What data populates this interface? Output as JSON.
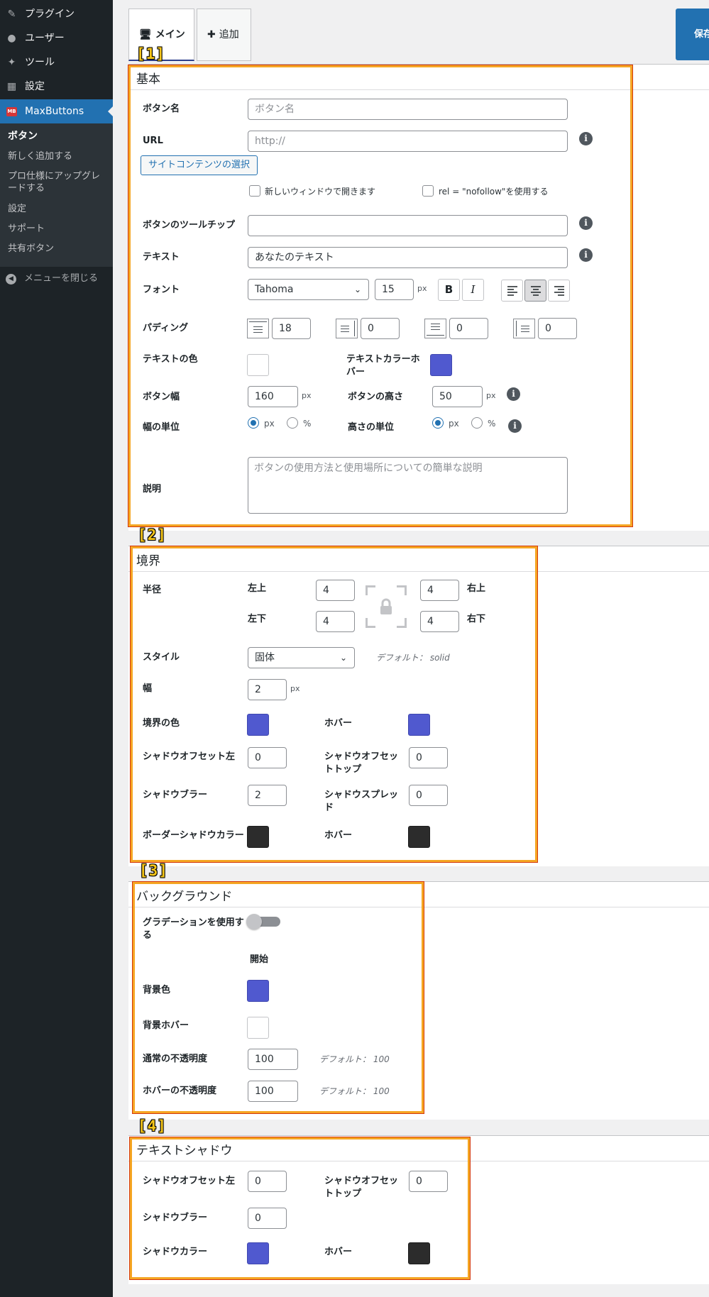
{
  "sidebar": {
    "items": [
      {
        "icon": "plugin-icon",
        "glyph": "✎",
        "label": "プラグイン"
      },
      {
        "icon": "user-icon",
        "glyph": "●",
        "label": "ユーザー"
      },
      {
        "icon": "wrench-icon",
        "glyph": "✦",
        "label": "ツール"
      },
      {
        "icon": "settings-icon",
        "glyph": "▦",
        "label": "設定"
      },
      {
        "icon": "maxbuttons-icon",
        "glyph": "MB",
        "label": "MaxButtons"
      }
    ],
    "submenu": [
      "ボタン",
      "新しく追加する",
      "プロ仕様にアップグレードする",
      "設定",
      "サポート",
      "共有ボタン"
    ],
    "close_menu": "メニューを閉じる"
  },
  "tabs": {
    "main": {
      "icon": "🖥",
      "label": "メイン"
    },
    "add": {
      "icon": "✚",
      "label": "追加"
    },
    "save": "保存"
  },
  "markers": [
    "[1]",
    "[2]",
    "[3]",
    "[4]"
  ],
  "basic": {
    "title": "基本",
    "button_name_label": "ボタン名",
    "button_name_placeholder": "ボタン名",
    "url_label": "URL",
    "url_placeholder": "http://",
    "site_content_button": "サイトコンテンツの選択",
    "new_window_label": "新しいウィンドウで開きます",
    "nofollow_label": "rel = \"nofollow\"を使用する",
    "tooltip_label": "ボタンのツールチップ",
    "text_label": "テキスト",
    "text_value": "あなたのテキスト",
    "font_label": "フォント",
    "font_value": "Tahoma",
    "font_size": "15",
    "px": "px",
    "bold": "B",
    "italic": "I",
    "padding_label": "パディング",
    "padding_values": [
      "18",
      "0",
      "0",
      "0"
    ],
    "text_color_label": "テキストの色",
    "text_color_hover_label": "テキストカラーホバー",
    "button_width_label": "ボタン幅",
    "button_width_value": "160",
    "button_height_label": "ボタンの高さ",
    "button_height_value": "50",
    "width_unit_label": "幅の単位",
    "height_unit_label": "高さの単位",
    "unit_px": "px",
    "unit_percent": "%",
    "description_label": "説明",
    "description_placeholder": "ボタンの使用方法と使用場所についての簡単な説明",
    "info": "i"
  },
  "border": {
    "title": "境界",
    "radius_label": "半径",
    "top_left": "左上",
    "top_right": "右上",
    "bottom_left": "左下",
    "bottom_right": "右下",
    "radius_tl": "4",
    "radius_tr": "4",
    "radius_bl": "4",
    "radius_br": "4",
    "style_label": "スタイル",
    "style_value": "固体",
    "style_default": "デフォルト： solid",
    "width_label": "幅",
    "width_value": "2",
    "px": "px",
    "color_label": "境界の色",
    "hover_label": "ホバー",
    "shadow_offset_left_label": "シャドウオフセット左",
    "shadow_offset_left_value": "0",
    "shadow_offset_top_label": "シャドウオフセットトップ",
    "shadow_offset_top_value": "0",
    "shadow_blur_label": "シャドウブラー",
    "shadow_blur_value": "2",
    "shadow_spread_label": "シャドウスプレッド",
    "shadow_spread_value": "0",
    "shadow_color_label": "ボーダーシャドウカラー",
    "shadow_hover_label": "ホバー"
  },
  "background": {
    "title": "バックグラウンド",
    "gradient_label": "グラデーションを使用する",
    "start_label": "開始",
    "bg_color_label": "背景色",
    "bg_hover_label": "背景ホバー",
    "opacity_label": "通常の不透明度",
    "opacity_value": "100",
    "opacity_default": "デフォルト： 100",
    "hover_opacity_label": "ホバーの不透明度",
    "hover_opacity_value": "100",
    "hover_opacity_default": "デフォルト： 100"
  },
  "text_shadow": {
    "title": "テキストシャドウ",
    "offset_left_label": "シャドウオフセット左",
    "offset_left_value": "0",
    "offset_top_label": "シャドウオフセットトップ",
    "offset_top_value": "0",
    "blur_label": "シャドウブラー",
    "blur_value": "0",
    "color_label": "シャドウカラー",
    "hover_label": "ホバー"
  },
  "colors": {
    "sidebar_bg": "#1d2327",
    "accent": "#2271b1",
    "swatch_blue": "#5059cf",
    "swatch_dark": "#2c2c2c",
    "highlight": "#f5a623"
  }
}
